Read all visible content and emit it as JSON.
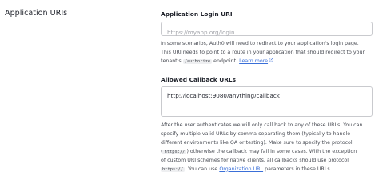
{
  "section": {
    "title": "Application URIs"
  },
  "login_uri": {
    "label": "Application Login URI",
    "value": "",
    "placeholder": "https://myapp.org/login",
    "help": {
      "line1": "In some scenarios, Auth0 will need to redirect to your application's login page.",
      "line2": "This URI needs to point to a route in your application that should redirect to your",
      "line3_pre": "tenant's",
      "line3_code": "/authorize",
      "line3_post": "endpoint.",
      "learn_more": "Learn more"
    }
  },
  "callback_urls": {
    "label": "Allowed Callback URLs",
    "value": "http://localhost:9080/anything/callback",
    "help": {
      "line1": "After the user authenticates we will only call back to any of these URLs. You can",
      "line2": "specify multiple valid URLs by comma-separating them (typically to handle",
      "line3": "different environments like QA or testing). Make sure to specify the protocol",
      "line4_code": "https://",
      "line4_post": "otherwise the callback may fail in some cases. With the exception",
      "line5": "of custom URI schemes for native clients, all callbacks should use protocol",
      "line6_code": "https://",
      "line6_mid": ". You can use",
      "line6_link": "Organization URL",
      "line6_post": "parameters in these URLs."
    }
  },
  "icons": {
    "external_link": "external-link-icon"
  },
  "colors": {
    "link": "#3a6fd8",
    "border": "#c9cace",
    "placeholder": "#a3a5ab"
  }
}
